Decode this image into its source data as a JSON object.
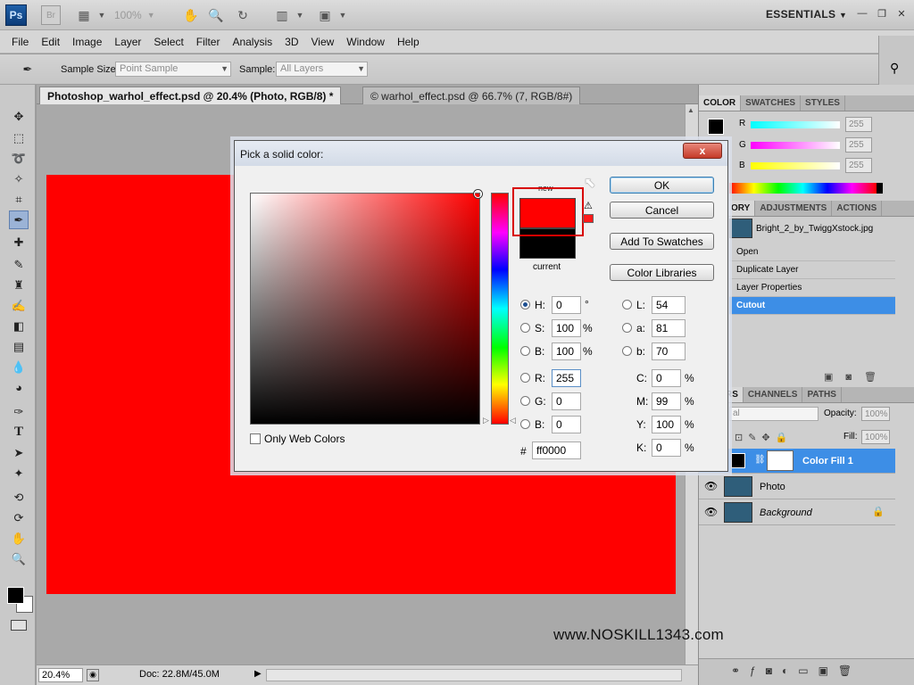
{
  "app": {
    "logo": "Ps",
    "bridge": "Br",
    "zoom_level": "100%",
    "workspace": "ESSENTIALS"
  },
  "menu": [
    "File",
    "Edit",
    "Image",
    "Layer",
    "Select",
    "Filter",
    "Analysis",
    "3D",
    "View",
    "Window",
    "Help"
  ],
  "options": {
    "sample_size_label": "Sample Size:",
    "sample_size_value": "Point Sample",
    "sample_label": "Sample:",
    "sample_value": "All Layers"
  },
  "tabs": [
    {
      "label": "Photoshop_warhol_effect.psd @ 20.4% (Photo, RGB/8) *"
    },
    {
      "label": "© warhol_effect.psd @ 66.7% (7, RGB/8#)"
    }
  ],
  "status": {
    "zoom": "20.4%",
    "doc": "Doc: 22.8M/45.0M"
  },
  "color_panel": {
    "tabs": [
      "COLOR",
      "SWATCHES",
      "STYLES"
    ],
    "channels": [
      {
        "label": "R",
        "value": "255"
      },
      {
        "label": "G",
        "value": "255"
      },
      {
        "label": "B",
        "value": "255"
      }
    ]
  },
  "history_panel": {
    "tabs": [
      "ORY",
      "ADJUSTMENTS",
      "ACTIONS"
    ],
    "snapshot": "Bright_2_by_TwiggXstock.jpg",
    "steps": [
      "Open",
      "Duplicate Layer",
      "Layer Properties",
      "Cutout"
    ]
  },
  "layers_panel": {
    "tabs": [
      "RS",
      "CHANNELS",
      "PATHS"
    ],
    "blend": "al",
    "opacity_label": "Opacity:",
    "opacity": "100%",
    "fill_label": "Fill:",
    "fill": "100%",
    "layers": [
      "Color Fill 1",
      "Photo",
      "Background"
    ]
  },
  "dialog": {
    "title": "Pick a solid color:",
    "close": "x",
    "new_label": "new",
    "current_label": "current",
    "buttons": {
      "ok": "OK",
      "cancel": "Cancel",
      "add_swatches": "Add To Swatches",
      "color_libraries": "Color Libraries"
    },
    "only_web": "Only Web Colors",
    "hsb": [
      {
        "label": "H:",
        "value": "0",
        "unit": "°"
      },
      {
        "label": "S:",
        "value": "100",
        "unit": "%"
      },
      {
        "label": "B:",
        "value": "100",
        "unit": "%"
      }
    ],
    "rgb": [
      {
        "label": "R:",
        "value": "255"
      },
      {
        "label": "G:",
        "value": "0"
      },
      {
        "label": "B:",
        "value": "0"
      }
    ],
    "lab": [
      {
        "label": "L:",
        "value": "54"
      },
      {
        "label": "a:",
        "value": "81"
      },
      {
        "label": "b:",
        "value": "70"
      }
    ],
    "cmyk": [
      {
        "label": "C:",
        "value": "0",
        "unit": "%"
      },
      {
        "label": "M:",
        "value": "99",
        "unit": "%"
      },
      {
        "label": "Y:",
        "value": "100",
        "unit": "%"
      },
      {
        "label": "K:",
        "value": "0",
        "unit": "%"
      }
    ],
    "hex_label": "#",
    "hex": "ff0000",
    "new_color": "#ff0000",
    "current_color": "#000000"
  },
  "watermark": "www.NOSKILL1343.com",
  "colors": {
    "canvas": "#ff0000",
    "selected_row": "#3d8ee6"
  }
}
